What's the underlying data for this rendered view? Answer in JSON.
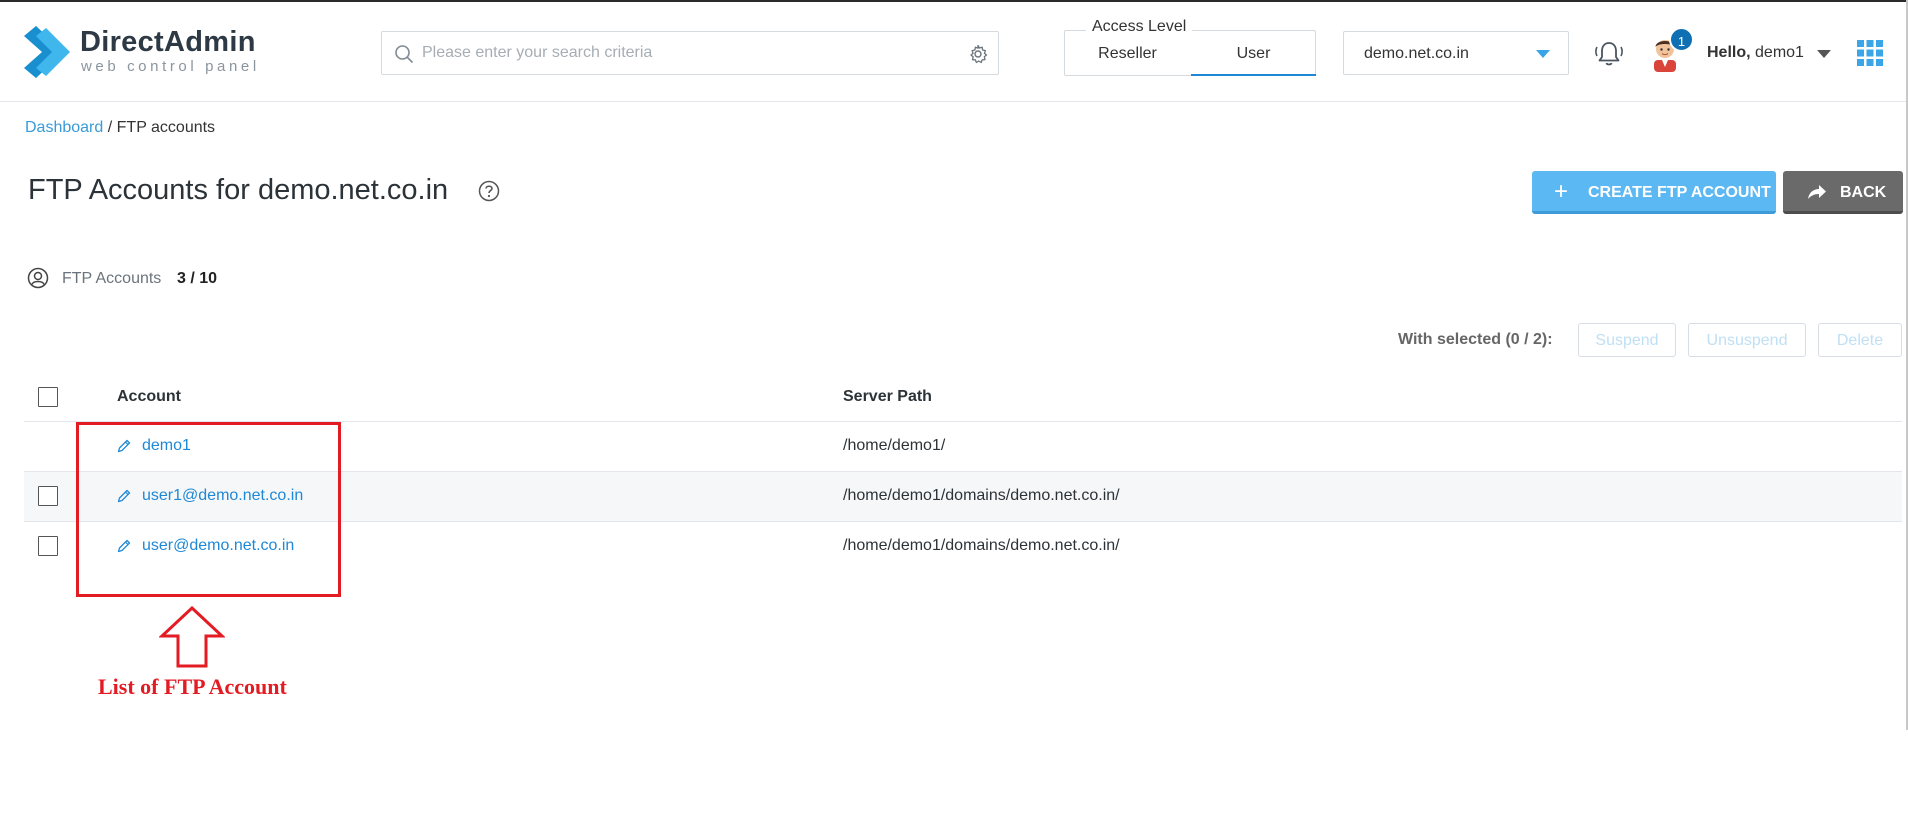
{
  "brand": {
    "name": "DirectAdmin",
    "tagline": "web control panel",
    "color": "#2ea8e6"
  },
  "search": {
    "placeholder": "Please enter your search criteria"
  },
  "access_level": {
    "legend": "Access Level",
    "options": [
      "Reseller",
      "User"
    ],
    "selected": "User"
  },
  "domain_select": {
    "value": "demo.net.co.in"
  },
  "notifications": {
    "count": "1"
  },
  "user_menu": {
    "greeting": "Hello,",
    "username": "demo1"
  },
  "breadcrumb": {
    "home": "Dashboard",
    "separator": "/",
    "current": "FTP accounts"
  },
  "page": {
    "title": "FTP Accounts for demo.net.co.in"
  },
  "actions": {
    "create_label": "CREATE FTP ACCOUNT",
    "back_label": "BACK"
  },
  "stats": {
    "label": "FTP Accounts",
    "value": "3 / 10"
  },
  "bulk": {
    "label": "With selected (0 / 2):",
    "suspend": "Suspend",
    "unsuspend": "Unsuspend",
    "delete": "Delete"
  },
  "table": {
    "headers": {
      "account": "Account",
      "path": "Server Path"
    },
    "rows": [
      {
        "account": "demo1",
        "path": "/home/demo1/",
        "selectable": false
      },
      {
        "account": "user1@demo.net.co.in",
        "path": "/home/demo1/domains/demo.net.co.in/",
        "selectable": true
      },
      {
        "account": "user@demo.net.co.in",
        "path": "/home/demo1/domains/demo.net.co.in/",
        "selectable": true
      }
    ]
  },
  "annotation": {
    "text": "List of FTP Account",
    "color": "#e31b23"
  }
}
